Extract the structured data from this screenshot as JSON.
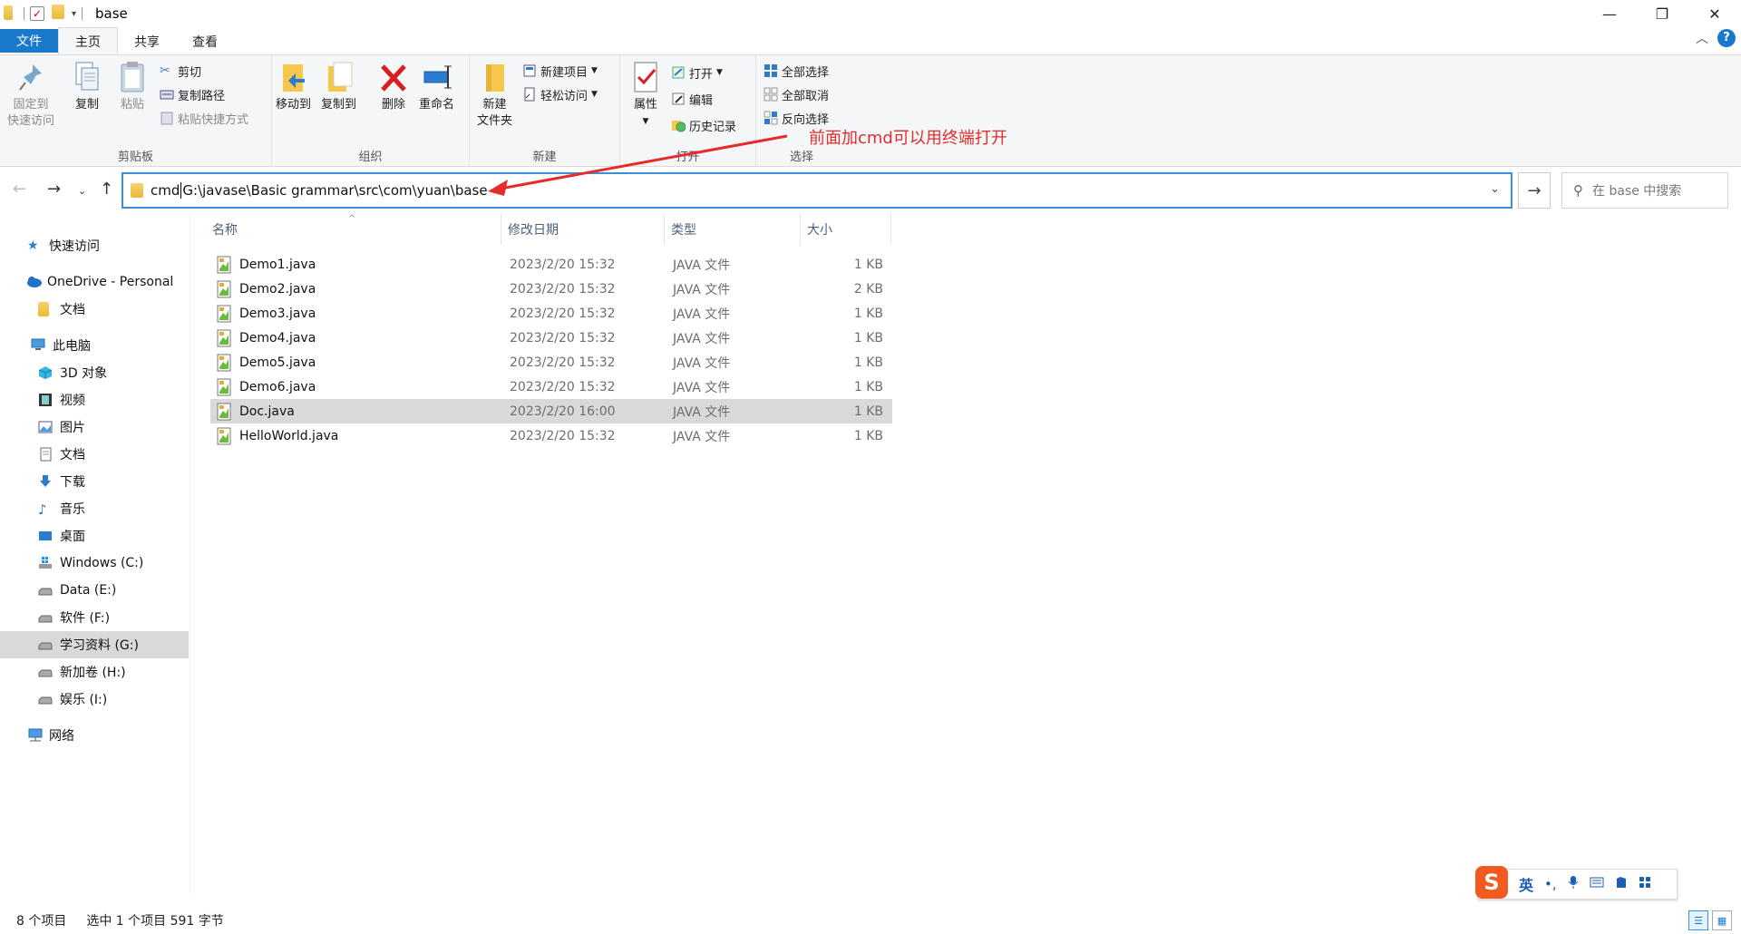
{
  "window": {
    "title": "base",
    "controls": {
      "minimize": "—",
      "maximize": "❐",
      "close": "✕"
    }
  },
  "ribbon_tabs": {
    "file": "文件",
    "home": "主页",
    "share": "共享",
    "view": "查看"
  },
  "ribbon": {
    "clipboard": {
      "label": "剪贴板",
      "pin_line1": "固定到",
      "pin_line2": "快速访问",
      "copy": "复制",
      "paste": "粘贴",
      "cut": "剪切",
      "copy_path": "复制路径",
      "paste_shortcut": "粘贴快捷方式"
    },
    "organize": {
      "label": "组织",
      "move_to": "移动到",
      "copy_to": "复制到",
      "delete": "删除",
      "rename": "重命名"
    },
    "new": {
      "label": "新建",
      "new_folder_line1": "新建",
      "new_folder_line2": "文件夹",
      "new_item": "新建项目",
      "easy_access": "轻松访问"
    },
    "open": {
      "label": "打开",
      "properties": "属性",
      "open": "打开",
      "edit": "编辑",
      "history": "历史记录"
    },
    "select": {
      "label": "选择",
      "select_all": "全部选择",
      "select_none": "全部取消",
      "invert": "反向选择"
    }
  },
  "address_bar": {
    "prefix": "cmd ",
    "path": "G:\\javase\\Basic grammar\\src\\com\\yuan\\base",
    "search_placeholder": "在 base 中搜索"
  },
  "annotation": {
    "text": "前面加cmd可以用终端打开",
    "color": "#e52b2b"
  },
  "sidebar": {
    "items": [
      {
        "label": "快速访问",
        "icon": "star-icon"
      },
      {
        "label": "OneDrive - Personal",
        "icon": "cloud-icon"
      },
      {
        "label": "文档",
        "icon": "folder-icon"
      },
      {
        "label": "此电脑",
        "icon": "computer-icon"
      },
      {
        "label": "3D 对象",
        "icon": "cube-icon"
      },
      {
        "label": "视频",
        "icon": "film-icon"
      },
      {
        "label": "图片",
        "icon": "picture-icon"
      },
      {
        "label": "文档",
        "icon": "document-icon"
      },
      {
        "label": "下载",
        "icon": "download-icon"
      },
      {
        "label": "音乐",
        "icon": "music-icon"
      },
      {
        "label": "桌面",
        "icon": "desktop-icon"
      },
      {
        "label": "Windows (C:)",
        "icon": "windows-drive-icon"
      },
      {
        "label": "Data (E:)",
        "icon": "drive-icon"
      },
      {
        "label": "软件 (F:)",
        "icon": "drive-icon"
      },
      {
        "label": "学习资料 (G:)",
        "icon": "drive-icon",
        "selected": true
      },
      {
        "label": "新加卷 (H:)",
        "icon": "drive-icon"
      },
      {
        "label": "娱乐 (I:)",
        "icon": "drive-icon"
      },
      {
        "label": "网络",
        "icon": "network-icon"
      }
    ]
  },
  "file_list": {
    "columns": [
      "名称",
      "修改日期",
      "类型",
      "大小"
    ],
    "rows": [
      {
        "name": "Demo1.java",
        "date": "2023/2/20 15:32",
        "type": "JAVA 文件",
        "size": "1 KB"
      },
      {
        "name": "Demo2.java",
        "date": "2023/2/20 15:32",
        "type": "JAVA 文件",
        "size": "2 KB"
      },
      {
        "name": "Demo3.java",
        "date": "2023/2/20 15:32",
        "type": "JAVA 文件",
        "size": "1 KB"
      },
      {
        "name": "Demo4.java",
        "date": "2023/2/20 15:32",
        "type": "JAVA 文件",
        "size": "1 KB"
      },
      {
        "name": "Demo5.java",
        "date": "2023/2/20 15:32",
        "type": "JAVA 文件",
        "size": "1 KB"
      },
      {
        "name": "Demo6.java",
        "date": "2023/2/20 15:32",
        "type": "JAVA 文件",
        "size": "1 KB"
      },
      {
        "name": "Doc.java",
        "date": "2023/2/20 16:00",
        "type": "JAVA 文件",
        "size": "1 KB",
        "selected": true
      },
      {
        "name": "HelloWorld.java",
        "date": "2023/2/20 15:32",
        "type": "JAVA 文件",
        "size": "1 KB"
      }
    ]
  },
  "status_bar": {
    "item_count": "8 个项目",
    "selection": "选中 1 个项目  591 字节"
  },
  "ime": {
    "logo": "S",
    "lang": "英",
    "punct": "•,",
    "mic": "🎤",
    "keyboard": "⌨",
    "skin": "👕",
    "grid": "▦"
  },
  "colors": {
    "accent": "#1979ca",
    "ribbon_bg": "#f5f6f7",
    "selection": "#d9d9d9",
    "annotation": "#e52b2b"
  }
}
